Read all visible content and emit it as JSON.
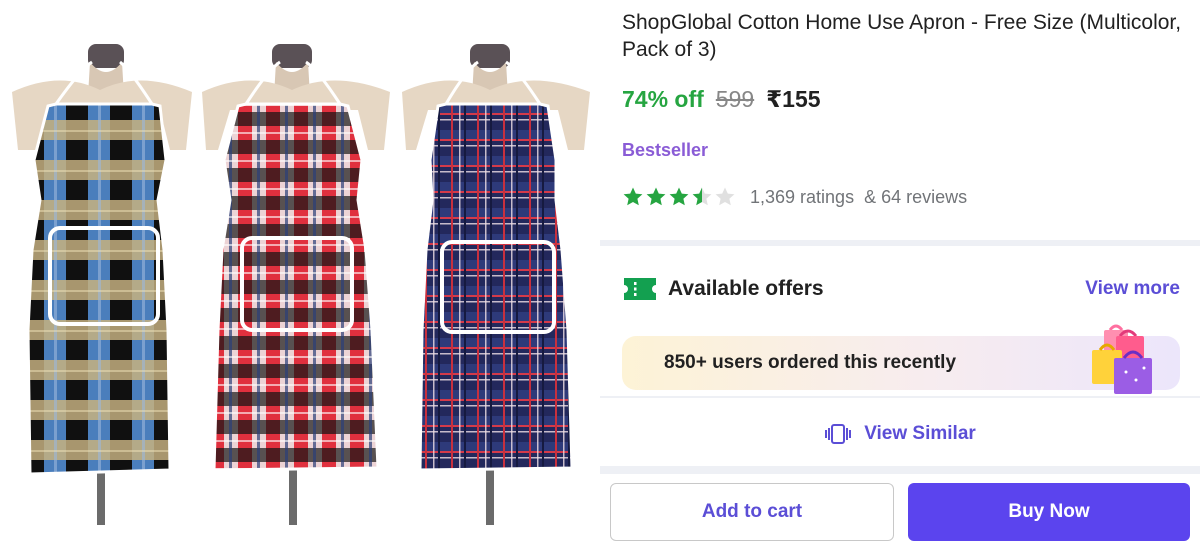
{
  "product": {
    "title": "ShopGlobal Cotton Home Use Apron - Free Size (Multicolor, Pack of 3)",
    "image_description_icon": "apron-product-image"
  },
  "pricing": {
    "discount": "74% off",
    "mrp": "599",
    "price": "₹155"
  },
  "badge": "Bestseller",
  "rating": {
    "stars": 3.5,
    "stars_max": 5,
    "ratings_text": "1,369 ratings",
    "reviews_text": "& 64 reviews",
    "star_color": "#26a541",
    "empty_star_color": "#e0e0e0"
  },
  "offers": {
    "icon": "offer-ticket-icon",
    "title": "Available offers",
    "view_more": "View more"
  },
  "recent": {
    "text": "850+ users ordered this recently",
    "icon": "shopping-bags-icon"
  },
  "similar": {
    "icon": "view-similar-icon",
    "label": "View Similar"
  },
  "actions": {
    "add_to_cart": "Add to cart",
    "buy_now": "Buy Now"
  },
  "colors": {
    "accent": "#5b44ee",
    "link": "#5b4ed6",
    "discount": "#26a541",
    "badge": "#8a5cd6"
  }
}
